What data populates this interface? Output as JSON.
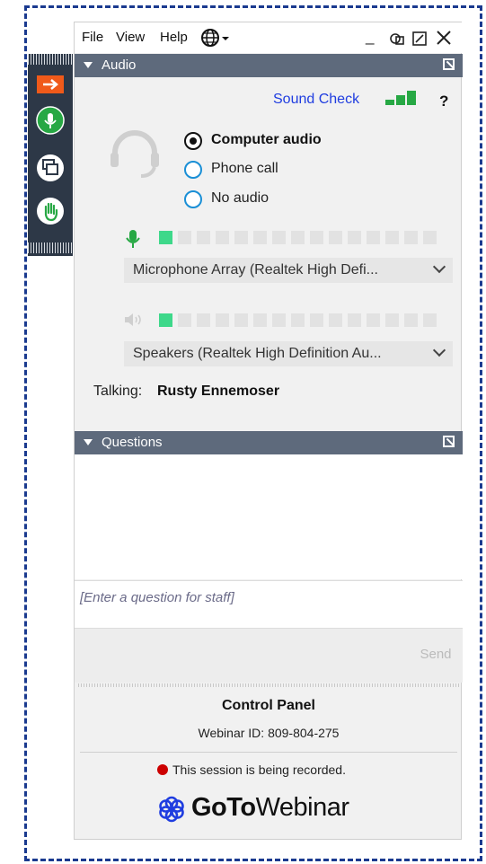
{
  "menu": {
    "file": "File",
    "view": "View",
    "help": "Help"
  },
  "audio": {
    "title": "Audio",
    "sound_check": "Sound Check",
    "help_mark": "?",
    "options": [
      {
        "label": "Computer audio",
        "selected": true
      },
      {
        "label": "Phone call",
        "selected": false
      },
      {
        "label": "No audio",
        "selected": false
      }
    ],
    "microphone": {
      "device": "Microphone Array (Realtek High Defi...",
      "level_segments": 1,
      "total_segments": 15
    },
    "speaker": {
      "device": "Speakers (Realtek High Definition Au...",
      "level_segments": 1,
      "total_segments": 15
    },
    "talking_label": "Talking:",
    "talking_name": "Rusty Ennemoser"
  },
  "questions": {
    "title": "Questions",
    "placeholder": "[Enter a question for staff]",
    "send": "Send"
  },
  "footer": {
    "title": "Control Panel",
    "webinar_id": "Webinar ID: 809-804-275",
    "recording": "This session is being recorded.",
    "brand_bold": "GoTo",
    "brand_light": "Webinar"
  },
  "colors": {
    "accent_orange": "#f05a1a",
    "mic_green": "#27a844",
    "link_blue": "#1f3de0",
    "header_gray": "#5e6a7c",
    "record_red": "#cc0000"
  },
  "icons": [
    "arrow-right-icon",
    "microphone-icon",
    "screen-share-icon",
    "raise-hand-icon",
    "globe-icon",
    "headset-icon",
    "signal-bars-icon",
    "speaker-icon",
    "expand-icon",
    "close-icon",
    "minimize-icon",
    "flower-logo-icon"
  ]
}
